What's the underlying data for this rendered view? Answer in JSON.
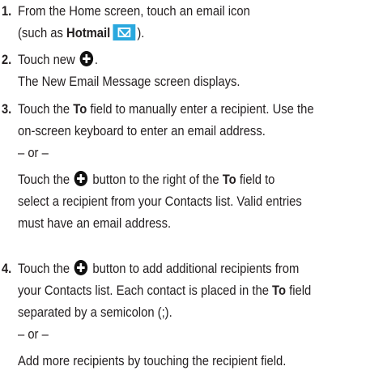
{
  "steps": [
    {
      "number": "1.",
      "text_before_bold": "From the Home screen, touch an email icon",
      "text_paren_open": "(such as ",
      "bold_app": "Hotmail",
      "text_paren_close": ")."
    },
    {
      "number": "2.",
      "text_before_icon": "Touch new",
      "text_after_icon": ".",
      "result": "The New Email Message screen displays."
    },
    {
      "number": "3.",
      "line1_before": "Touch the ",
      "line1_bold": "To",
      "line1_after": " field to manually enter a recipient. Use the",
      "line2": "on-screen keyboard to enter an email address.",
      "or": "– or –",
      "alt_line1_before": "Touch the",
      "alt_line1_mid": "button to the right of the ",
      "alt_line1_bold": "To",
      "alt_line1_after": " field to",
      "alt_line2": "select a recipient from your Contacts list. Valid entries",
      "alt_line3": "must have an email address."
    },
    {
      "number": "4.",
      "line1_before": "Touch the",
      "line1_after": "button to add additional recipients from",
      "line2_before": "your Contacts list. Each contact is placed in the ",
      "line2_bold": "To",
      "line2_after": " field",
      "line3": "separated by a semicolon (;).",
      "or": "– or –",
      "alt_line1": "Add more recipients by touching the recipient field."
    }
  ],
  "icons": {
    "add": "plus-circle-icon",
    "email": "envelope-icon",
    "email_tile_color": "#2aa8de"
  }
}
